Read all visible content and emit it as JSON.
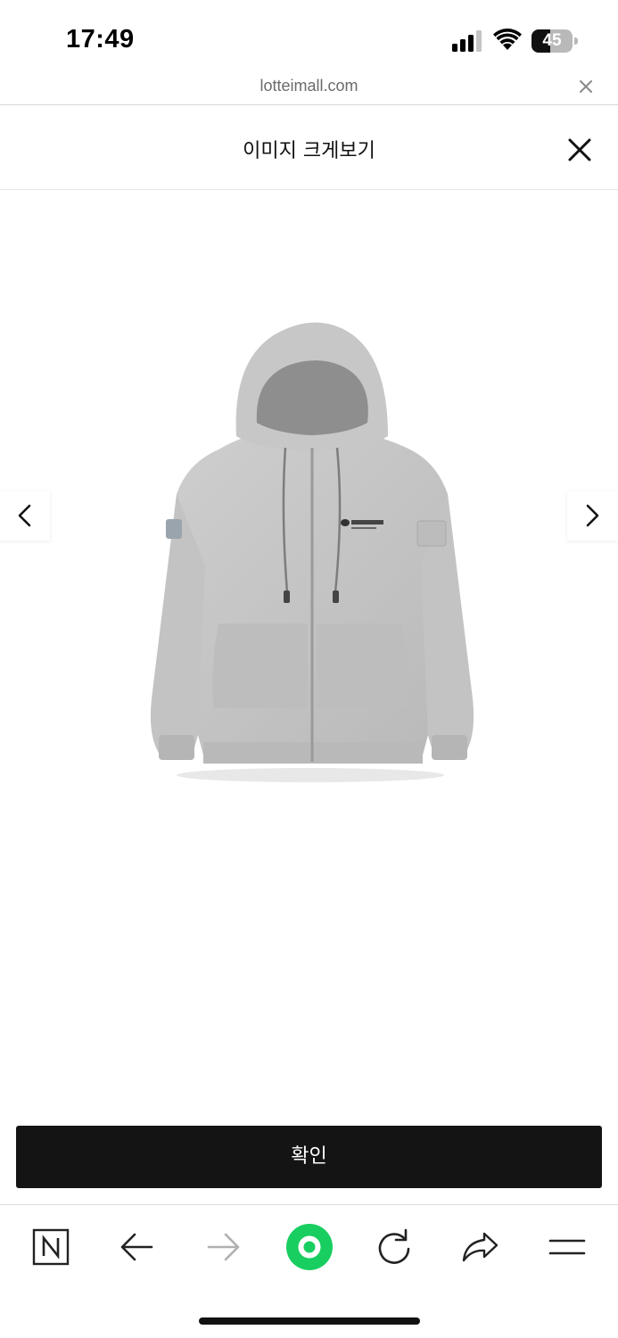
{
  "status_bar": {
    "time": "17:49",
    "battery_level": "45",
    "battery_fraction": 0.45,
    "icons": [
      "signal-icon",
      "wifi-icon",
      "battery-icon"
    ]
  },
  "url_bar": {
    "url": "lotteimall.com",
    "close_icon": "close-icon"
  },
  "modal": {
    "title": "이미지 크게보기",
    "close_icon": "close-icon"
  },
  "viewer": {
    "image_alt": "grey zip-up hoodie",
    "prev_icon": "chevron-left-icon",
    "next_icon": "chevron-right-icon"
  },
  "confirm_label": "확인",
  "toolbar": {
    "items": [
      "naver-icon",
      "back-icon",
      "forward-icon",
      "home-green-icon",
      "refresh-icon",
      "share-icon",
      "menu-icon"
    ],
    "accent_color": "#19ce60"
  }
}
